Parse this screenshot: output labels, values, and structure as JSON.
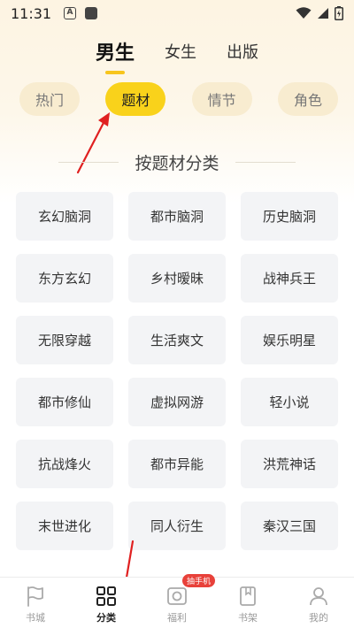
{
  "status_bar": {
    "time": "11:31",
    "a_badge": "A"
  },
  "gender_tabs": [
    {
      "label": "男生",
      "active": true
    },
    {
      "label": "女生",
      "active": false
    },
    {
      "label": "出版",
      "active": false
    }
  ],
  "sort_pills": [
    {
      "label": "热门",
      "active": false
    },
    {
      "label": "题材",
      "active": true
    },
    {
      "label": "情节",
      "active": false
    },
    {
      "label": "角色",
      "active": false
    }
  ],
  "section_title": "按题材分类",
  "genres": [
    "玄幻脑洞",
    "都市脑洞",
    "历史脑洞",
    "东方玄幻",
    "乡村暧昧",
    "战神兵王",
    "无限穿越",
    "生活爽文",
    "娱乐明星",
    "都市修仙",
    "虚拟网游",
    "轻小说",
    "抗战烽火",
    "都市异能",
    "洪荒神话",
    "末世进化",
    "同人衍生",
    "秦汉三国"
  ],
  "bottom_nav": [
    {
      "label": "书城",
      "icon": "bookstore-flag-icon",
      "active": false
    },
    {
      "label": "分类",
      "icon": "category-grid-icon",
      "active": true
    },
    {
      "label": "福利",
      "icon": "welfare-camera-icon",
      "active": false,
      "badge": "抽手机"
    },
    {
      "label": "书架",
      "icon": "bookshelf-icon",
      "active": false
    },
    {
      "label": "我的",
      "icon": "profile-person-icon",
      "active": false
    }
  ],
  "colors": {
    "accent": "#f9d21b",
    "pill_bg": "#f8ecd0",
    "badge": "#e8413a",
    "annotation_arrow": "#e02020"
  }
}
